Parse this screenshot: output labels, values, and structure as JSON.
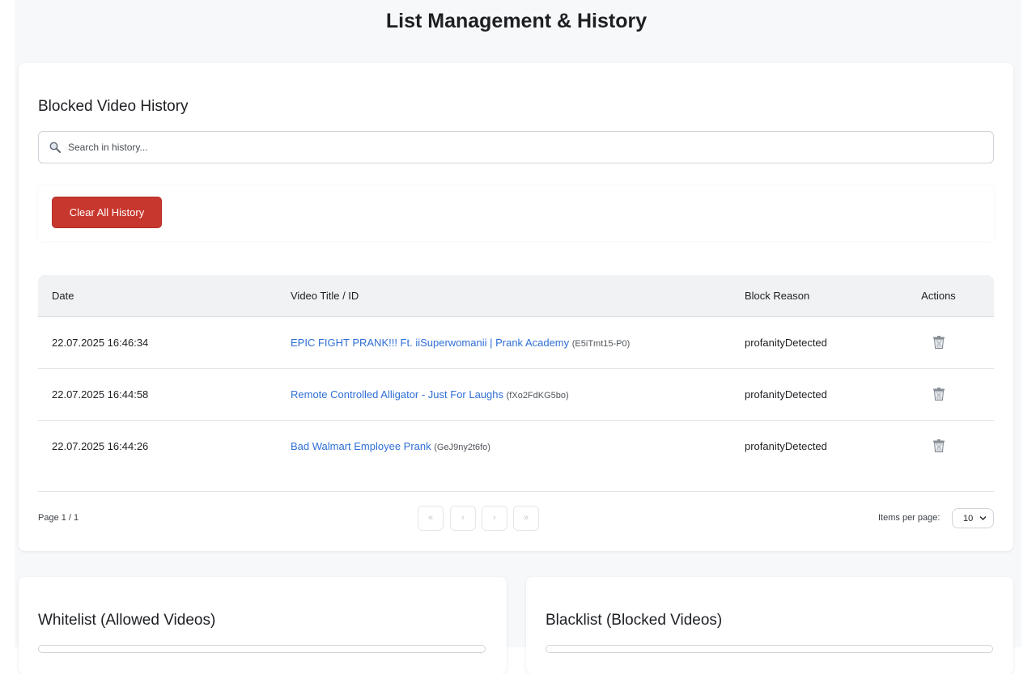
{
  "page": {
    "title": "List Management & History"
  },
  "history": {
    "title": "Blocked Video History",
    "search_placeholder": "Search in history...",
    "clear_button": "Clear All History",
    "columns": {
      "date": "Date",
      "title": "Video Title / ID",
      "reason": "Block Reason",
      "actions": "Actions"
    },
    "rows": [
      {
        "date": "22.07.2025 16:46:34",
        "title": "EPIC FIGHT PRANK!!! Ft. iiSuperwomanii | Prank Academy",
        "id": "(E5iTmt15-P0)",
        "reason": "profanityDetected"
      },
      {
        "date": "22.07.2025 16:44:58",
        "title": "Remote Controlled Alligator - Just For Laughs",
        "id": "(fXo2FdKG5bo)",
        "reason": "profanityDetected"
      },
      {
        "date": "22.07.2025 16:44:26",
        "title": "Bad Walmart Employee Prank",
        "id": "(GeJ9ny2t6fo)",
        "reason": "profanityDetected"
      }
    ],
    "pagination": {
      "page_info": "Page 1 / 1",
      "first": "«",
      "prev": "‹",
      "next": "›",
      "last": "»",
      "items_per_page_label": "Items per page:",
      "items_per_page_value": "10"
    }
  },
  "whitelist": {
    "title": "Whitelist (Allowed Videos)"
  },
  "blacklist": {
    "title": "Blacklist (Blocked Videos)"
  },
  "icons": {
    "search": "magnifier-icon",
    "delete": "trash-icon",
    "select": "chevron-down-icon"
  },
  "colors": {
    "accent_link": "#2f6fd6",
    "danger": "#c8372d",
    "background": "#f7f8fa"
  }
}
